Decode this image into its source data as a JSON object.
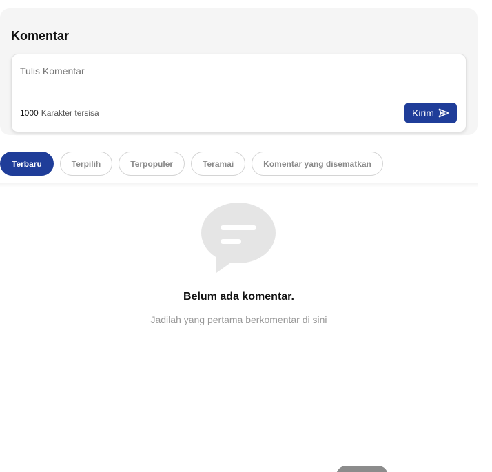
{
  "comment_section": {
    "title": "Komentar",
    "input": {
      "placeholder": "Tulis Komentar",
      "value": ""
    },
    "char_counter": {
      "count": "1000",
      "label": "Karakter tersisa"
    },
    "send_button": {
      "label": "Kirim",
      "icon": "send-icon"
    }
  },
  "sort_tabs": [
    {
      "label": "Terbaru",
      "active": true
    },
    {
      "label": "Terpilih",
      "active": false
    },
    {
      "label": "Terpopuler",
      "active": false
    },
    {
      "label": "Teramai",
      "active": false
    },
    {
      "label": "Komentar yang disematkan",
      "active": false
    }
  ],
  "empty_state": {
    "icon": "chat-bubble-icon",
    "title": "Belum ada komentar.",
    "subtitle": "Jadilah yang pertama berkomentar di sini"
  },
  "colors": {
    "accent": "#1f3d99",
    "panel_background": "#f5f5f5",
    "muted_text": "#999999",
    "empty_icon": "#e5e5e5"
  }
}
